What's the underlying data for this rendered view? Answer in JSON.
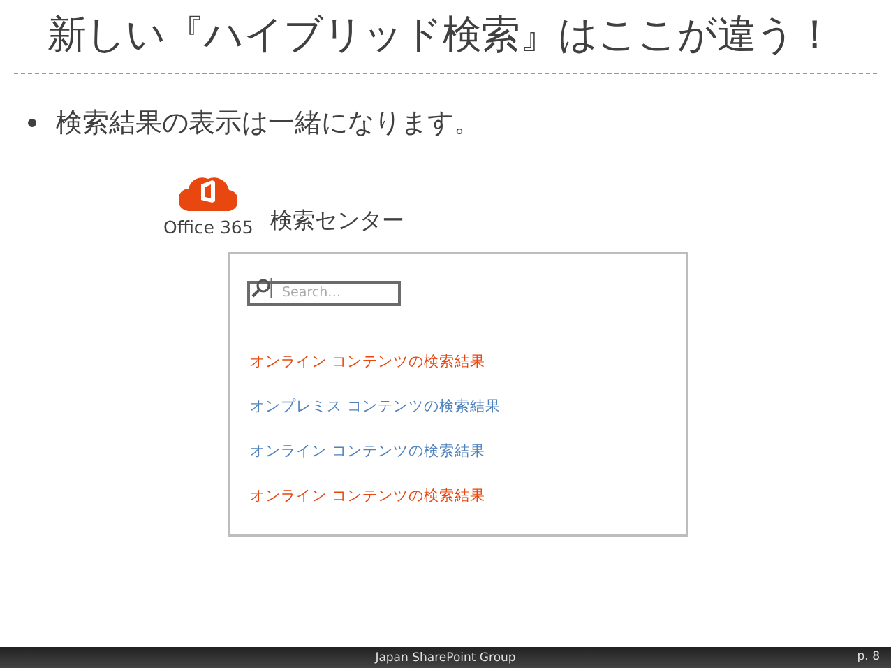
{
  "title": "新しい『ハイブリッド検索』はここが違う！",
  "bullet": "検索結果の表示は一緒になります。",
  "logo": {
    "label": "Office 365"
  },
  "search_center": {
    "title": "検索センター",
    "search": {
      "placeholder": "Search…"
    },
    "results": [
      {
        "text": "オンライン コンテンツの検索結果",
        "color": "#e8470f"
      },
      {
        "text": "オンプレミス コンテンツの検索結果",
        "color": "#4f81bd"
      },
      {
        "text": "オンライン コンテンツの検索結果",
        "color": "#4f81bd"
      },
      {
        "text": "オンライン コンテンツの検索結果",
        "color": "#e8470f"
      }
    ]
  },
  "footer": {
    "center": "Japan SharePoint Group",
    "page": "p. 8"
  }
}
